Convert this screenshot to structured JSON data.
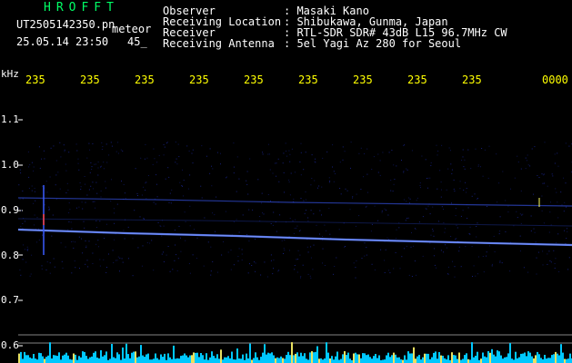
{
  "header": {
    "app_title": "HROFFT",
    "file_name": "UT2505142350.pn",
    "meteor_label": "meteor",
    "date_time": "25.05.14 23:50",
    "frame_index": "45_"
  },
  "station_info": [
    {
      "label": "Observer",
      "value": ": Masaki Kano"
    },
    {
      "label": "Receiving Location",
      "value": ": Shibukawa, Gunma, Japan"
    },
    {
      "label": "Receiver",
      "value": ": RTL-SDR SDR# 43dB L15 96.7MHz CW"
    },
    {
      "label": "Receiving Antenna",
      "value": ": 5el Yagi Az 280 for Seoul"
    }
  ],
  "axis": {
    "unit": "kHz",
    "time_ticks": [
      "235",
      "235",
      "235",
      "235",
      "235",
      "235",
      "235",
      "235",
      "235",
      "0000"
    ],
    "freq_ticks": [
      "1.1",
      "1.0",
      "0.9",
      "0.8",
      "0.7",
      "0.6"
    ]
  },
  "colors": {
    "title": "#00ff66",
    "text": "#ffffff",
    "tick": "#ffff00",
    "trace": "#4d6bff",
    "baseline": "#00c8ff"
  }
}
